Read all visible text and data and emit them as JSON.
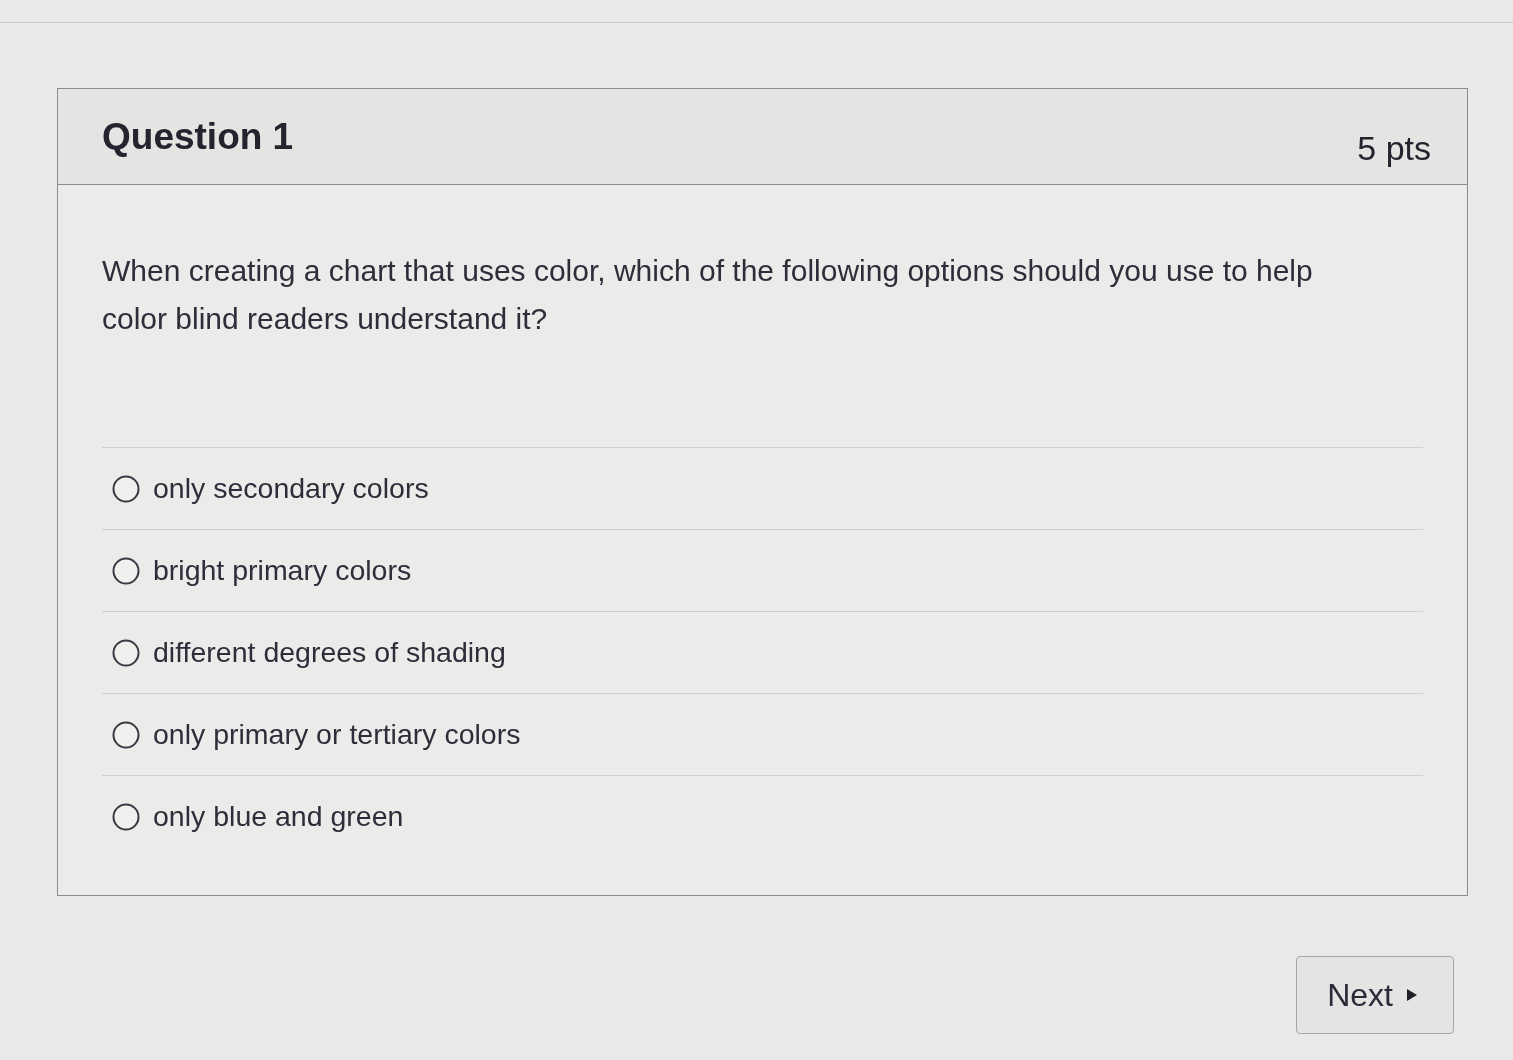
{
  "question": {
    "title": "Question 1",
    "points": "5 pts",
    "text": "When creating a chart that uses color, which of the following options should you use to help color blind readers understand it?",
    "answers": [
      {
        "label": "only secondary colors",
        "selected": false
      },
      {
        "label": "bright primary colors",
        "selected": false
      },
      {
        "label": "different degrees of shading",
        "selected": false
      },
      {
        "label": "only primary or tertiary colors",
        "selected": false
      },
      {
        "label": "only blue and green",
        "selected": false
      }
    ]
  },
  "next_button": {
    "label": "Next"
  }
}
